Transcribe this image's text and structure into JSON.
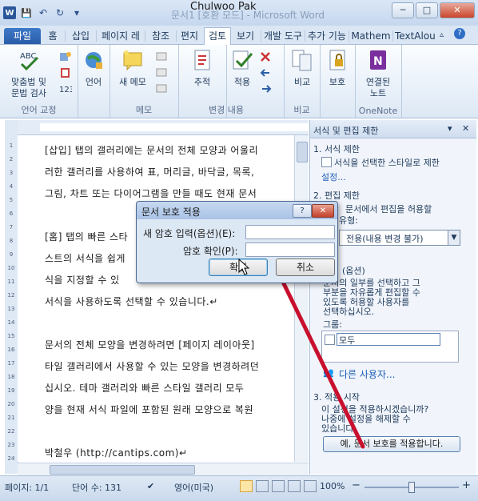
{
  "window": {
    "title": "문서1 [호환 모드] - Microsoft Word",
    "user": "Chulwoo Pak"
  },
  "qat": {
    "word": "W",
    "save": "💾",
    "undo": "↶",
    "redo": "↻",
    "customize": "▾"
  },
  "window_buttons": {
    "minimize": "─",
    "maximize": "□",
    "close": "✕"
  },
  "tabs": [
    "파일",
    "홈",
    "삽입",
    "페이지 레",
    "참조",
    "편지",
    "검토",
    "보기",
    "개발 도구",
    "추가 기능",
    "Mathem",
    "TextAlou"
  ],
  "ribbon": {
    "proofing": {
      "btn": "맞춤법 및\n문법 검사",
      "label": "언어 교정"
    },
    "language": {
      "btn": "언어"
    },
    "comments": {
      "btn": "새 메모",
      "label": "메모"
    },
    "tracking": {
      "track": "추적",
      "accept": "적용",
      "label": "변경 내용"
    },
    "compare": {
      "btn": "비교",
      "label": "비교"
    },
    "protect": {
      "btn": "보호"
    },
    "onenote": {
      "btn": "연결된\n노트",
      "label": "OneNote"
    }
  },
  "document": {
    "paragraphs": [
      "[삽입] 탭의 갤러리에는 문서의 전체 모양과 어울리",
      "러한 갤러리를 사용하여 표, 머리글, 바닥글, 목록,",
      "그림, 차트 또는 다이어그램을 만들 때도 현재 문서",
      "",
      "[홈] 탭의 빠른 스타",
      "스트의 서식을 쉽게",
      "식을 지정할 수 있",
      "서식을 사용하도록 선택할 수 있습니다.↵",
      "",
      "문서의 전체 모양을 변경하려면 [페이지 레이아웃]",
      "타일 갤러리에서 사용할 수 있는 모양을 변경하려던",
      "십시오. 테마 갤러리와 빠른 스타일 갤러리 모두 ",
      "양을 현재 서식 파일에 포함된 원래 모양으로 복원",
      "",
      "박철우 (http://cantips.com)↵"
    ]
  },
  "vruler_numbers": [
    "1",
    "2",
    "3",
    "4",
    "5",
    "6",
    "7",
    "8",
    "9",
    "10",
    "11",
    "12",
    "13",
    "14",
    "15",
    "16",
    "17",
    "18",
    "19",
    "20",
    "21",
    "22",
    "23",
    "24"
  ],
  "pane": {
    "title": "서식 및 편집 제한",
    "s1": "1. 서식 제한",
    "s1_check": "서식을 선택한 스타일로 제한",
    "s1_link": "설정...",
    "s2": "2. 편집 제한",
    "s2_text_a": "문서에서 편집을 허용할",
    "s2_text_b": "유형:",
    "s2_dropdown": "전용(내용 변경 불가)",
    "exceptions": "(옵션)",
    "exc_text": [
      "문서의 일부를 선택하고 그",
      "부분을 자유롭게 편집할 수",
      "있도록 허용할 사용자를",
      "선택하십시오."
    ],
    "group_label": "그룹:",
    "group_item": "모두",
    "more_users": "다른 사용자...",
    "s3": "3. 적용 시작",
    "s3_text": [
      "이 설정을 적용하시겠습니까?",
      "나중에 설정을 해제할 수",
      "있습니다."
    ],
    "apply_button": "예, 문서 보호를 적용합니다."
  },
  "dialog": {
    "title": "문서 보호 적용",
    "help": "?",
    "close": "✕",
    "pwd_label": "새 암호 입력(옵션)(E):",
    "confirm_label": "암호 확인(P):",
    "ok": "확인",
    "cancel": "취소"
  },
  "status": {
    "page": "페이지: 1/1",
    "words": "단어 수: 131",
    "lang": "영어(미국)",
    "zoom": "100%",
    "zoom_minus": "−",
    "zoom_plus": "+"
  },
  "colors": {
    "annotation_arrow": "#c8102e",
    "file_tab": "#2a5ca8",
    "accent": "#1e395b"
  }
}
